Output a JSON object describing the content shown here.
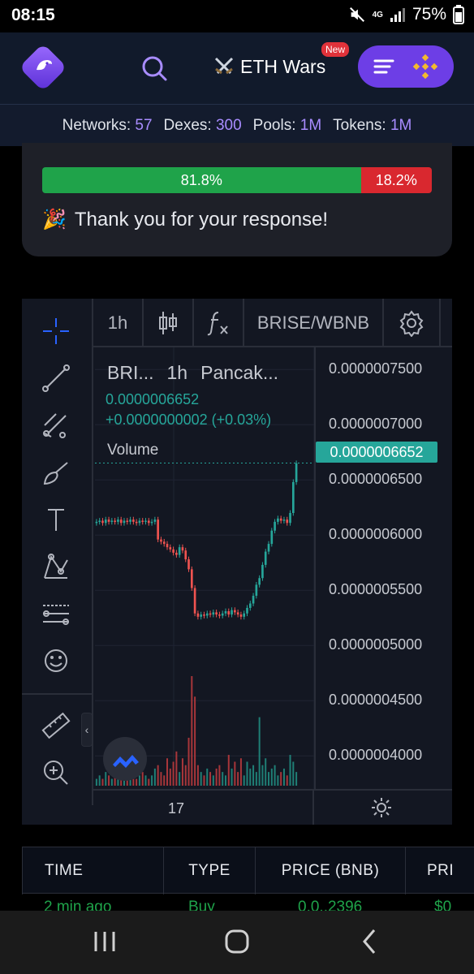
{
  "status_bar": {
    "time": "08:15",
    "network": "4G",
    "battery": "75%"
  },
  "header": {
    "promo_label": "ETH Wars",
    "new_badge": "New",
    "colors": {
      "background": "#111a2b",
      "accent": "#6d3ee6",
      "binance": "#f3ba2f"
    }
  },
  "stats": {
    "networks_label": "Networks:",
    "networks_value": "57",
    "dexes_label": "Dexes:",
    "dexes_value": "300",
    "pools_label": "Pools:",
    "pools_value": "1M",
    "tokens_label": "Tokens:",
    "tokens_value": "1M"
  },
  "poll": {
    "yes_percent": "81.8%",
    "no_percent": "18.2%",
    "yes_fraction": 0.818,
    "thanks_emoji": "🎉",
    "thanks_text": "Thank you for your response!"
  },
  "chart": {
    "interval": "1h",
    "symbol": "BRISE/WBNB",
    "legend_symbol": "BRI...",
    "legend_interval": "1h",
    "legend_exchange": "Pancak...",
    "legend_price": "0.0000006652",
    "legend_change": "+0.0000000002 (+0.03%)",
    "volume_label": "Volume",
    "last_price": "0.0000006652",
    "time_label": "17",
    "price_ticks": [
      "0.0000007500",
      "0.0000007000",
      "0.0000006500",
      "0.0000006000",
      "0.0000005500",
      "0.0000005000",
      "0.0000004500",
      "0.0000004000"
    ]
  },
  "chart_data": {
    "type": "candlestick",
    "title": "BRISE/WBNB",
    "x_tick_labels": [
      "17"
    ],
    "y_tick_labels": [
      "0.0000007500",
      "0.0000007000",
      "0.0000006500",
      "0.0000006000",
      "0.0000005500",
      "0.0000005000",
      "0.0000004500",
      "0.0000004000"
    ],
    "ylim": [
      3.7e-07,
      7.7e-07
    ],
    "series": [
      {
        "name": "Volume"
      }
    ],
    "close": [
      6.12e-07,
      6.13e-07,
      6.11e-07,
      6.14e-07,
      6.12e-07,
      6.13e-07,
      6.12e-07,
      6.14e-07,
      6.11e-07,
      6.13e-07,
      6.12e-07,
      6.14e-07,
      6.12e-07,
      6.11e-07,
      6.13e-07,
      6.12e-07,
      6.13e-07,
      6.11e-07,
      6.12e-07,
      6.14e-07,
      5.96e-07,
      5.94e-07,
      5.92e-07,
      5.89e-07,
      5.87e-07,
      5.84e-07,
      5.82e-07,
      5.89e-07,
      5.86e-07,
      5.78e-07,
      5.69e-07,
      5.52e-07,
      5.29e-07,
      5.26e-07,
      5.28e-07,
      5.27e-07,
      5.29e-07,
      5.28e-07,
      5.3e-07,
      5.28e-07,
      5.27e-07,
      5.29e-07,
      5.31e-07,
      5.28e-07,
      5.32e-07,
      5.3e-07,
      5.28e-07,
      5.26e-07,
      5.29e-07,
      5.34e-07,
      5.38e-07,
      5.45e-07,
      5.55e-07,
      5.61e-07,
      5.73e-07,
      5.85e-07,
      5.92e-07,
      6.04e-07,
      6.12e-07,
      6.15e-07,
      6.13e-07,
      6.14e-07,
      6.11e-07,
      6.2e-07,
      6.48e-07,
      6.65e-07
    ],
    "volume": [
      2,
      3,
      2,
      4,
      3,
      2,
      5,
      3,
      2,
      3,
      4,
      2,
      3,
      2,
      3,
      4,
      3,
      2,
      3,
      5,
      6,
      4,
      3,
      8,
      5,
      7,
      10,
      4,
      8,
      6,
      14,
      32,
      26,
      6,
      4,
      3,
      5,
      4,
      3,
      5,
      6,
      4,
      3,
      9,
      5,
      7,
      4,
      8,
      3,
      7,
      5,
      6,
      4,
      20,
      6,
      8,
      4,
      5,
      6,
      3,
      4,
      5,
      3,
      9,
      7,
      4
    ]
  },
  "trades": {
    "headers": [
      "TIME",
      "TYPE",
      "PRICE (BNB)",
      "PRI"
    ],
    "row": [
      "2 min ago",
      "Buy",
      "0.0..2396",
      "$0"
    ]
  }
}
